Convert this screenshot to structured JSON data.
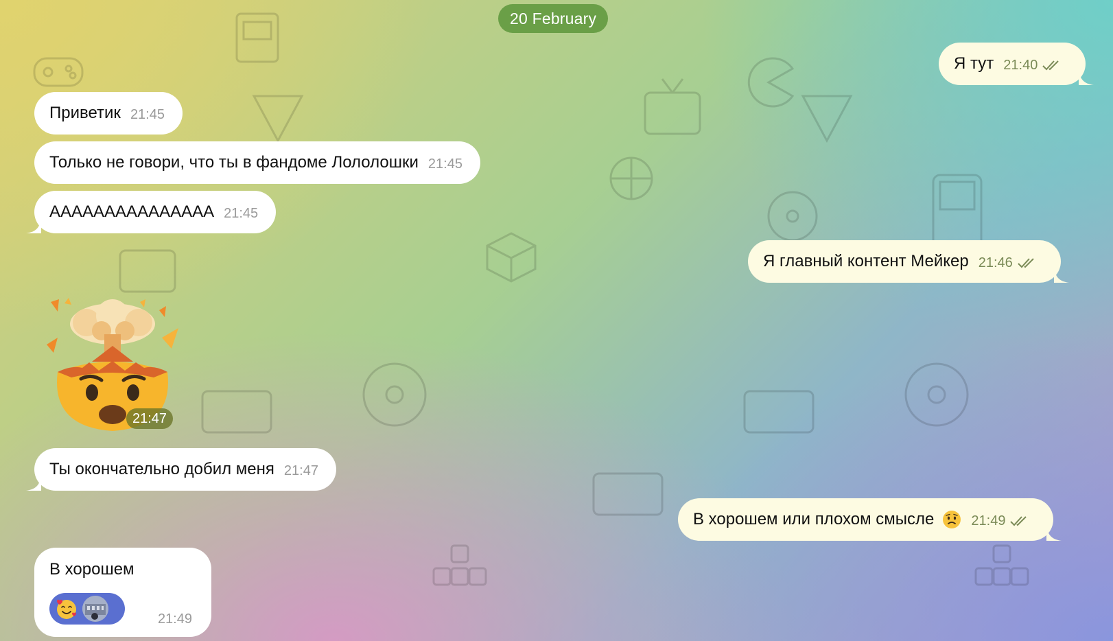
{
  "date_separator": "20 February",
  "messages": [
    {
      "text": "Я тут",
      "time": "21:40"
    },
    {
      "text": "Приветик",
      "time": "21:45"
    },
    {
      "text": "Только не говори, что ты в фандоме Лололошки",
      "time": "21:45"
    },
    {
      "text": "AAAAAAAAAAAAAAA",
      "time": "21:45"
    },
    {
      "text": "Я главный контент Мейкер",
      "time": "21:46"
    },
    {
      "sticker": "exploding-head-emoji",
      "time": "21:47"
    },
    {
      "text": "Ты окончательно добил меня",
      "time": "21:47"
    },
    {
      "text": "В хорошем или плохом смысле",
      "emoji": "😟",
      "time": "21:49"
    },
    {
      "text": "В хорошем",
      "time": "21:49",
      "reaction": "🥰"
    }
  ],
  "colors": {
    "date_pill": "#6a9f47",
    "incoming_bubble": "#ffffff",
    "outgoing_bubble": "#fdfbe2",
    "reaction_pill": "#5a6fd0"
  }
}
